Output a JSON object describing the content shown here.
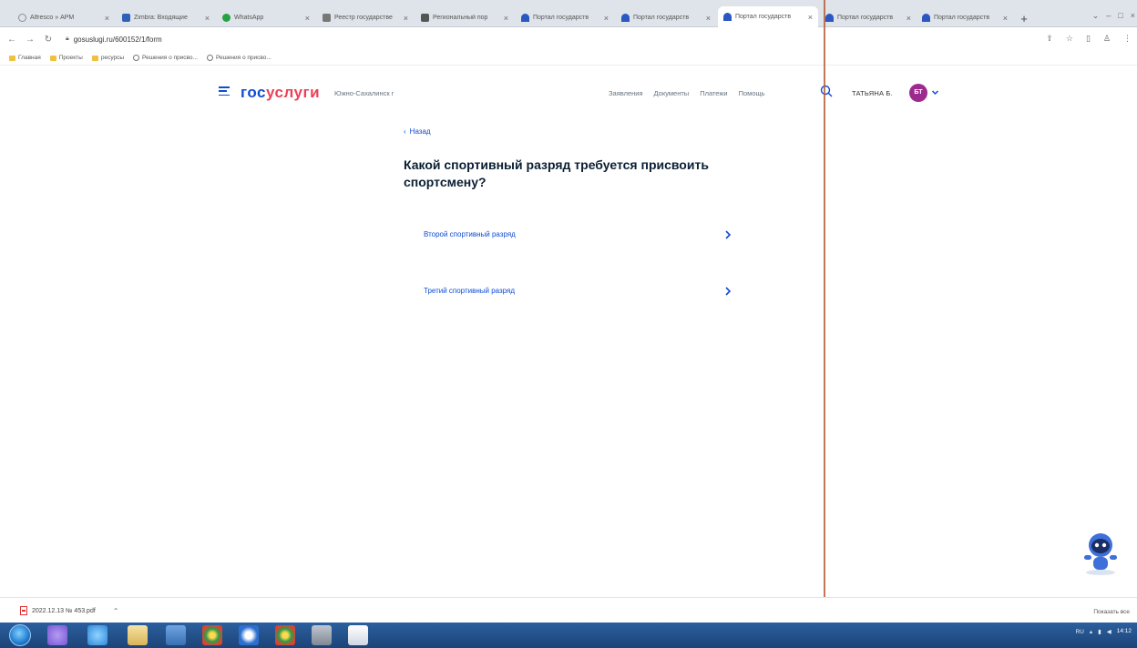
{
  "browser": {
    "tabs": [
      {
        "label": "Alfresco » АРМ",
        "icon_color": "#8a8f99"
      },
      {
        "label": "Zimbra: Входящие",
        "icon_color": "#2d62b8"
      },
      {
        "label": "WhatsApp",
        "icon_color": "#25a244"
      },
      {
        "label": "Реестр государстве",
        "icon_color": "#777777"
      },
      {
        "label": "Региональный пор",
        "icon_color": "#555555"
      },
      {
        "label": "Портал государств",
        "icon_color": "#2b57c2"
      },
      {
        "label": "Портал государств",
        "icon_color": "#2b57c2"
      },
      {
        "label": "Портал государств",
        "icon_color": "#2b57c2"
      },
      {
        "label": "Портал государств",
        "icon_color": "#2b57c2"
      },
      {
        "label": "Портал государств",
        "icon_color": "#2b57c2"
      }
    ],
    "active_tab_index": 7,
    "url": "gosuslugi.ru/600152/1/form",
    "bookmarks": [
      {
        "label": "Главная",
        "kind": "folder"
      },
      {
        "label": "Проекты",
        "kind": "folder"
      },
      {
        "label": "ресурсы",
        "kind": "folder"
      },
      {
        "label": "Решения о присво...",
        "kind": "globe"
      },
      {
        "label": "Решения о присво...",
        "kind": "globe"
      }
    ]
  },
  "header": {
    "logo_part1": "гос",
    "logo_part2": "услуги",
    "city": "Южно-Сахалинск г",
    "nav": [
      "Заявления",
      "Документы",
      "Платежи",
      "Помощь"
    ],
    "username": "ТАТЬЯНА Б.",
    "avatar_initials": "БТ"
  },
  "content": {
    "back_label": "Назад",
    "title": "Какой спортивный разряд требуется присвоить спортсмену?",
    "options": [
      {
        "label": "Второй спортивный разряд"
      },
      {
        "label": "Третий спортивный разряд"
      }
    ]
  },
  "download": {
    "file_name": "2022.12.13 № 453.pdf",
    "show_all": "Показать все"
  },
  "taskbar": {
    "lang": "RU",
    "time": "14:12"
  },
  "colors": {
    "brand_blue": "#0d4cd3",
    "brand_red": "#ee3f58",
    "avatar_bg": "#9d2b8e"
  }
}
